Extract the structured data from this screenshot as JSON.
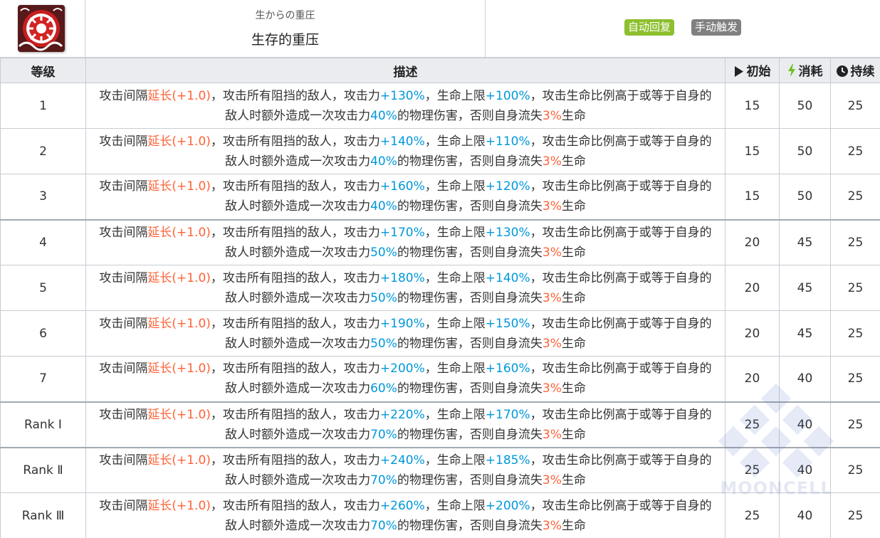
{
  "skill": {
    "icon": "skill-icon-red-ring",
    "name_jp": "生からの重圧",
    "name_cn": "生存的重压",
    "tags": [
      {
        "label": "自动回复",
        "color": "#8dbf2e"
      },
      {
        "label": "手动触发",
        "color": "#808080"
      }
    ]
  },
  "table": {
    "headers": {
      "level": "等级",
      "description": "描述",
      "initial": "初始",
      "cost": "消耗",
      "duration": "持续"
    },
    "rows": [
      {
        "level": "1",
        "atk": "+130%",
        "hp": "+100%",
        "extra": "40%",
        "initial": "15",
        "cost": "50",
        "duration": "25"
      },
      {
        "level": "2",
        "atk": "+140%",
        "hp": "+110%",
        "extra": "40%",
        "initial": "15",
        "cost": "50",
        "duration": "25"
      },
      {
        "level": "3",
        "atk": "+160%",
        "hp": "+120%",
        "extra": "40%",
        "initial": "15",
        "cost": "50",
        "duration": "25"
      },
      {
        "level": "4",
        "atk": "+170%",
        "hp": "+130%",
        "extra": "50%",
        "initial": "20",
        "cost": "45",
        "duration": "25"
      },
      {
        "level": "5",
        "atk": "+180%",
        "hp": "+140%",
        "extra": "50%",
        "initial": "20",
        "cost": "45",
        "duration": "25"
      },
      {
        "level": "6",
        "atk": "+190%",
        "hp": "+150%",
        "extra": "50%",
        "initial": "20",
        "cost": "45",
        "duration": "25"
      },
      {
        "level": "7",
        "atk": "+200%",
        "hp": "+160%",
        "extra": "60%",
        "initial": "20",
        "cost": "40",
        "duration": "25"
      },
      {
        "level": "Rank Ⅰ",
        "atk": "+220%",
        "hp": "+170%",
        "extra": "70%",
        "initial": "25",
        "cost": "40",
        "duration": "25"
      },
      {
        "level": "Rank Ⅱ",
        "atk": "+240%",
        "hp": "+185%",
        "extra": "70%",
        "initial": "25",
        "cost": "40",
        "duration": "25"
      },
      {
        "level": "Rank Ⅲ",
        "atk": "+260%",
        "hp": "+200%",
        "extra": "70%",
        "initial": "25",
        "cost": "40",
        "duration": "25"
      }
    ],
    "desc_text": {
      "p1": "攻击间隔",
      "interval": "延长(+1.0)",
      "p2": "，攻击所有阻挡的敌人，攻击力",
      "p3": "，生命上限",
      "p4": "，攻击生命比例高于或等于自身的敌人时额外造成一次攻击力",
      "p5": "的物理伤害，否则自身流失",
      "hp_loss": "3%",
      "p6": "生命"
    }
  },
  "watermark": {
    "text": "MOONCELL"
  },
  "colors": {
    "highlight_red": "#ff6237",
    "highlight_blue": "#0098dc",
    "header_bg": "#eaecf0"
  }
}
